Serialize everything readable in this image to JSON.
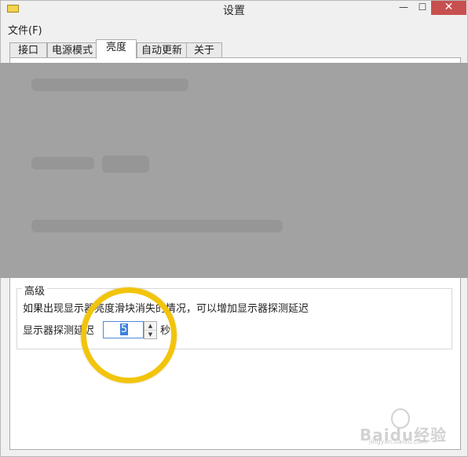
{
  "window": {
    "title": "设置",
    "buttons": {
      "minimize": "—",
      "maximize": "☐",
      "close": "✕"
    }
  },
  "menu": {
    "file": "文件(F)"
  },
  "tabs": [
    {
      "label": "接口"
    },
    {
      "label": "电源模式"
    },
    {
      "label": "亮度",
      "active": true
    },
    {
      "label": "自动更新"
    },
    {
      "label": "关于"
    }
  ],
  "advanced": {
    "title": "高级",
    "advice": "如果出现显示器亮度滑块消失的情况，可以增加显示器探测延迟",
    "delay_label": "显示器探测延迟",
    "delay_value": "5",
    "unit": "秒"
  },
  "spinner": {
    "up": "▲",
    "down": "▼"
  },
  "watermark": {
    "text": "Baidu经验",
    "url": "jingyan.baidu.com"
  },
  "colors": {
    "highlight": "#f2c40c",
    "selection": "#3d7fdc",
    "blur": "#a2a2a2"
  }
}
